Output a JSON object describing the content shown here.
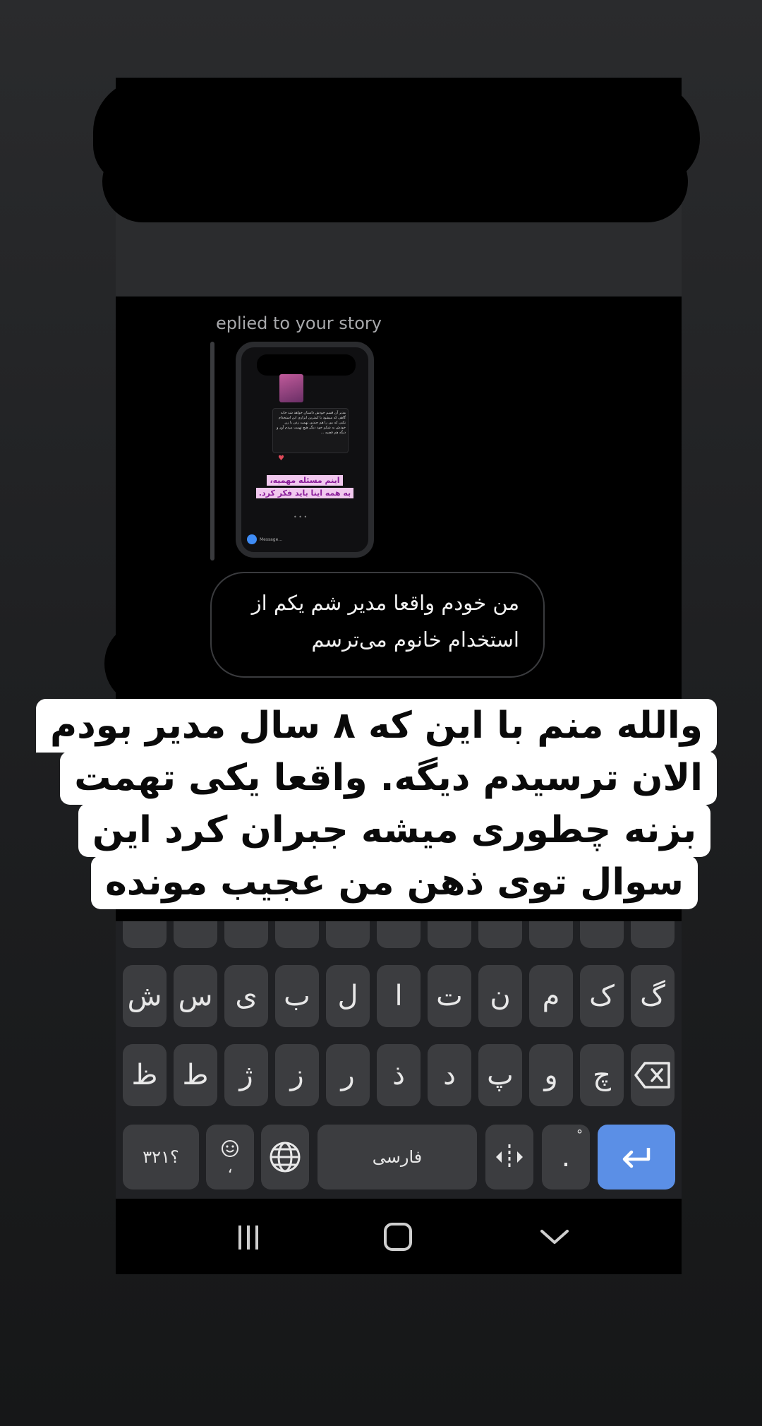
{
  "conversation": {
    "reply_label": "eplied to your story",
    "story_thumbnail": {
      "text_card": "مدیر آن قسم خودش داستان خواهد شد خانه گاهی که میشود با کمترین ابزاری این استخدام نکنی که من را هم چندین تهمت زدن با زن خودش به شکم خود دیگر هیچ تهمت مردم آور و دیگه هم قضیه ...",
      "caption_line1": "اینم مسئله مهمیه،",
      "caption_line2": "به همه اینا باید فکر کرد.",
      "message_placeholder": "Message..."
    },
    "bubble_line1": "من خودم واقعا مدیر شم یکم از",
    "bubble_line2": "استخدام خانوم می‌ترسم"
  },
  "overlay_caption": {
    "line1": "والله منم با این که ۸ سال مدیر بودم",
    "line2": "الان ترسیدم دیگه. واقعا یکی تهمت",
    "line3": "بزنه چطوری میشه جبران کرد این",
    "line4": "سوال توی ذهن من عجیب مونده"
  },
  "keyboard": {
    "row_middle": [
      "گ",
      "ک",
      "م",
      "ن",
      "ت",
      "ا",
      "ل",
      "ب",
      "ی",
      "س",
      "ش"
    ],
    "row_bottom": [
      "ظ",
      "ط",
      "ژ",
      "ز",
      "ر",
      "ذ",
      "د",
      "پ",
      "و",
      "چ"
    ],
    "numbers_key": "؟۳۲۱",
    "emoji_comma": "،",
    "space_label": "فارسی",
    "period_key": ".",
    "accent_color": "#5b8fe6"
  },
  "icons": {
    "backspace": "backspace-icon",
    "globe": "globe-icon",
    "emoji": "emoji-icon",
    "cursor": "cursor-move-icon",
    "enter": "enter-icon",
    "recents": "recents-icon",
    "home": "home-icon",
    "back": "back-chevron-icon"
  }
}
